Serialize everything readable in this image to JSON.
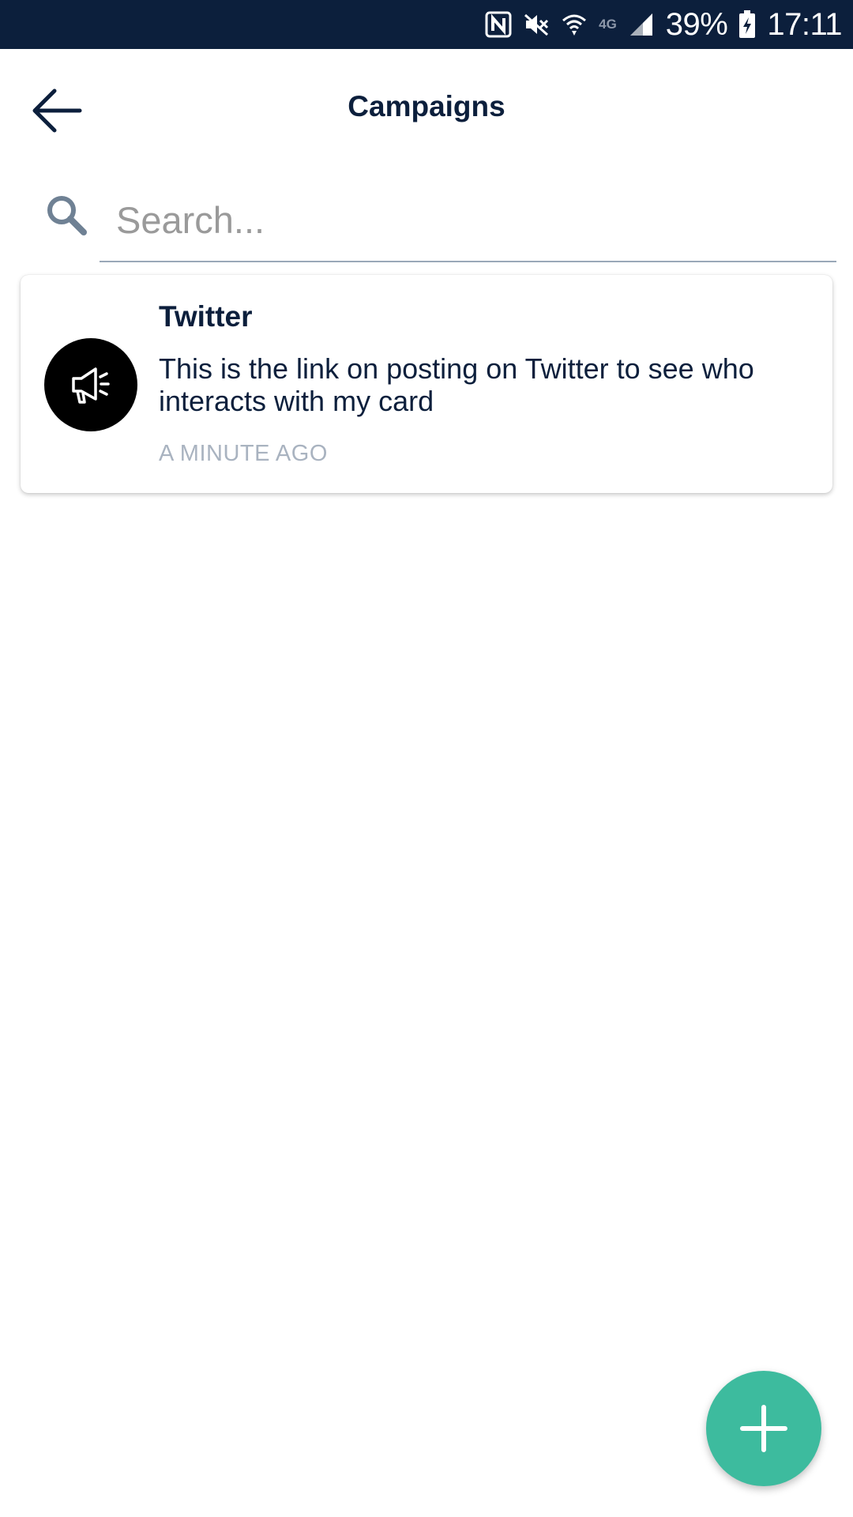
{
  "status_bar": {
    "battery_text": "39%",
    "time": "17:11",
    "network_label": "4G",
    "icons": [
      "nfc-icon",
      "mute-icon",
      "wifi-icon",
      "network-type-icon",
      "signal-icon",
      "battery-charging-icon"
    ]
  },
  "header": {
    "title": "Campaigns",
    "back_icon": "arrow-left-icon"
  },
  "search": {
    "placeholder": "Search...",
    "value": "",
    "icon": "search-icon"
  },
  "campaigns": [
    {
      "title": "Twitter",
      "description": "This is the link on posting on Twitter to see who interacts with my card",
      "time": "A MINUTE AGO",
      "icon": "megaphone-icon"
    }
  ],
  "fab": {
    "icon": "plus-icon"
  },
  "colors": {
    "status_bar_bg": "#0c1f3c",
    "text_primary": "#0c1f3c",
    "text_muted": "#a9b3c0",
    "placeholder": "#9a9a9a",
    "fab_bg": "#3dbb9e",
    "avatar_bg": "#000000"
  }
}
